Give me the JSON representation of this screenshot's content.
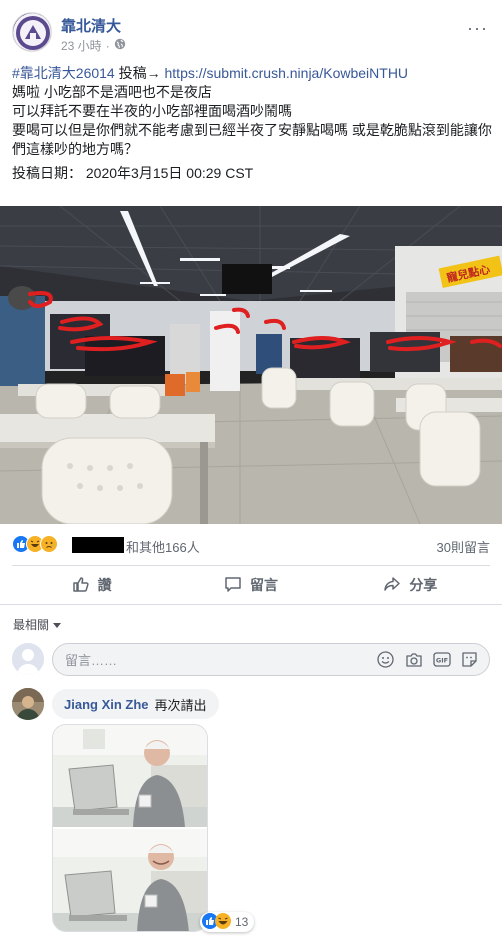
{
  "post": {
    "page_name": "靠北清大",
    "time": "23 小時",
    "time_sep": "·",
    "more": "···",
    "hashtag": "#靠北清大26014",
    "submit_label": "投稿→",
    "submit_link": "https://submit.crush.ninja/KowbeiNTHU",
    "lines": [
      "媽啦 小吃部不是酒吧也不是夜店",
      "可以拜託不要在半夜的小吃部裡面喝酒吵鬧嗎",
      "要喝可以但是你們就不能考慮到已經半夜了安靜點喝嗎 或是乾脆點滾到能讓你們這樣吵的地方嗎？"
    ],
    "date_line": "投稿日期： 2020年3月15日 00:29 CST",
    "sign_text": "寵兒點心"
  },
  "stats": {
    "others": "和其他166人",
    "comments": "30則留言"
  },
  "actions": {
    "like": "讚",
    "comment": "留言",
    "share": "分享"
  },
  "comments_section": {
    "sort_label": "最相關",
    "input_placeholder": "留言……",
    "gif_label": "GIF",
    "comment": {
      "author": "Jiang Xin Zhe",
      "text": "再次請出",
      "reaction_count": "13"
    }
  },
  "colors": {
    "link": "#385898",
    "name": "#365899",
    "like_blue": "#1877f2",
    "haha_yellow": "#f7b125",
    "muted": "#606770"
  }
}
